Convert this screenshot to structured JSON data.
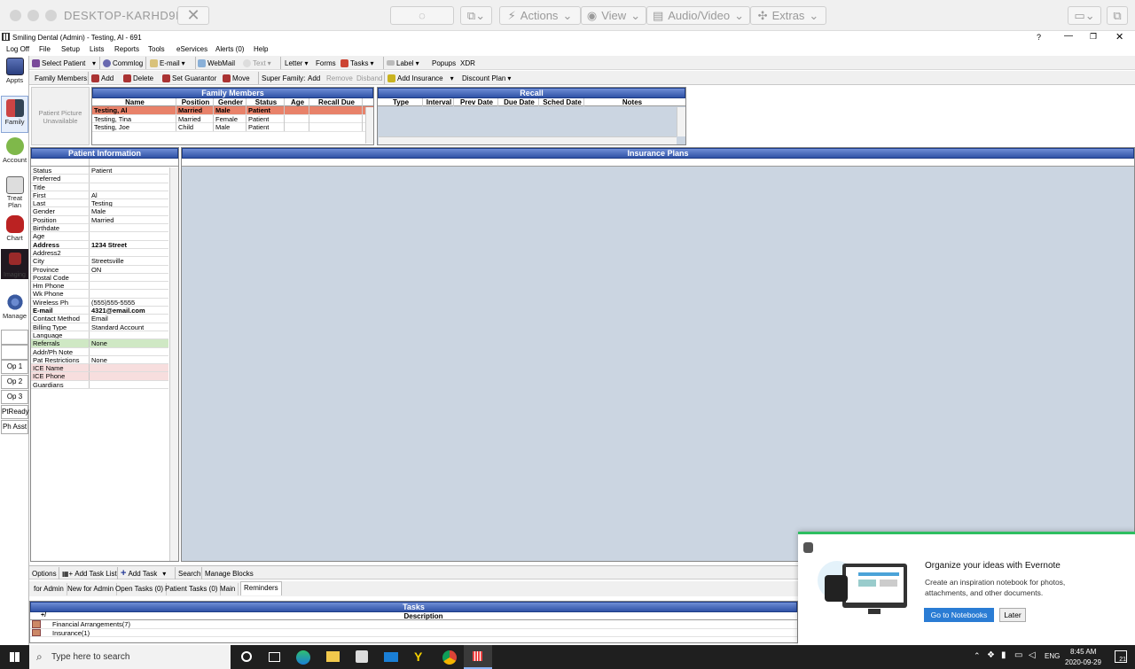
{
  "rd": {
    "host": "DESKTOP-KARHD9I",
    "actions": "Actions",
    "view": "View",
    "audio_video": "Audio/Video",
    "extras": "Extras"
  },
  "app": {
    "title": "Smiling Dental (Admin) - Testing, Al - 691",
    "help": "?"
  },
  "menu": [
    "Log Off",
    "File",
    "Setup",
    "Lists",
    "Reports",
    "Tools",
    "eServices",
    "Alerts (0)",
    "Help"
  ],
  "toolbar1": {
    "select_patient": "Select Patient",
    "commlog": "Commlog",
    "email": "E-mail",
    "webmail": "WebMail",
    "text": "Text",
    "letter": "Letter",
    "forms": "Forms",
    "tasks": "Tasks",
    "label": "Label",
    "popups": "Popups",
    "xdr": "XDR"
  },
  "toolbar2": {
    "family_members": "Family Members:",
    "add": "Add",
    "delete": "Delete",
    "set_guarantor": "Set Guarantor",
    "move": "Move",
    "super_family": "Super Family:",
    "sf_add": "Add",
    "sf_remove": "Remove",
    "sf_disband": "Disband",
    "add_insurance": "Add Insurance",
    "discount_plan": "Discount Plan"
  },
  "nav": {
    "appts": "Appts",
    "family": "Family",
    "account": "Account",
    "treat_plan_1": "Treat",
    "treat_plan_2": "Plan",
    "chart": "Chart",
    "imaging": "Imaging",
    "manage": "Manage",
    "ops": [
      "Op 1",
      "Op 2",
      "Op 3",
      "PtReady",
      "Ph Asst"
    ]
  },
  "picture": {
    "line1": "Patient Picture",
    "line2": "Unavailable"
  },
  "family": {
    "title": "Family Members",
    "columns": [
      "Name",
      "Position",
      "Gender",
      "Status",
      "Age",
      "Recall Due"
    ],
    "rows": [
      [
        "Testing, Al",
        "Married",
        "Male",
        "Patient",
        "",
        ""
      ],
      [
        "Testing, Tina",
        "Married",
        "Female",
        "Patient",
        "",
        ""
      ],
      [
        "Testing, Joe",
        "Child",
        "Male",
        "Patient",
        "",
        ""
      ]
    ]
  },
  "recall": {
    "title": "Recall",
    "columns": [
      "Type",
      "Interval",
      "Prev Date",
      "Due Date",
      "Sched Date",
      "Notes"
    ]
  },
  "patient_info": {
    "title": "Patient Information",
    "rows": [
      {
        "k": "Status",
        "v": "Patient"
      },
      {
        "k": "Preferred",
        "v": ""
      },
      {
        "k": "Title",
        "v": ""
      },
      {
        "k": "First",
        "v": "Al"
      },
      {
        "k": "Last",
        "v": "Testing"
      },
      {
        "k": "Gender",
        "v": "Male"
      },
      {
        "k": "Position",
        "v": "Married"
      },
      {
        "k": "Birthdate",
        "v": ""
      },
      {
        "k": "Age",
        "v": ""
      },
      {
        "k": "Address",
        "v": "1234 Street"
      },
      {
        "k": "Address2",
        "v": ""
      },
      {
        "k": "City",
        "v": "Streetsville"
      },
      {
        "k": "Province",
        "v": "ON"
      },
      {
        "k": "Postal Code",
        "v": ""
      },
      {
        "k": "Hm Phone",
        "v": ""
      },
      {
        "k": "Wk Phone",
        "v": ""
      },
      {
        "k": "Wireless Ph",
        "v": "(555)555-5555"
      },
      {
        "k": "E-mail",
        "v": "4321@email.com"
      },
      {
        "k": "Contact Method",
        "v": "Email"
      },
      {
        "k": "Billing Type",
        "v": "Standard Account"
      },
      {
        "k": "Language",
        "v": ""
      },
      {
        "k": "Referrals",
        "v": "None"
      },
      {
        "k": "Addr/Ph Note",
        "v": ""
      },
      {
        "k": "Pat Restrictions",
        "v": "None"
      },
      {
        "k": "ICE Name",
        "v": ""
      },
      {
        "k": "ICE Phone",
        "v": ""
      },
      {
        "k": "Guardians",
        "v": ""
      }
    ]
  },
  "insurance": {
    "title": "Insurance Plans"
  },
  "taskbar_tools": {
    "options": "Options",
    "add_task_list": "Add Task List",
    "add_task": "Add Task",
    "search": "Search",
    "manage_blocks": "Manage Blocks"
  },
  "task_tabs": [
    "for Admin",
    "New for Admin",
    "Open Tasks (0)",
    "Patient Tasks (0)",
    "Main",
    "Reminders"
  ],
  "tasks": {
    "title": "Tasks",
    "col_toggle": "+/",
    "col_desc": "Description",
    "rows": [
      "Financial Arrangements(7)",
      "Insurance(1)"
    ]
  },
  "toast": {
    "title": "Organize your ideas with Evernote",
    "body": "Create an inspiration notebook for photos, attachments, and other documents.",
    "primary": "Go to Notebooks",
    "secondary": "Later"
  },
  "win_taskbar": {
    "search_placeholder": "Type here to search",
    "lang": "ENG",
    "time": "8:45 AM",
    "date": "2020-09-29",
    "badge": "21"
  },
  "colors": {
    "header_blue": "#2f52a6",
    "selected_row": "#e8826a",
    "referral_green": "#cfe8c4",
    "ice_pink": "#f7dede",
    "evernote_green": "#2dbe60",
    "primary_button": "#2a7cd4"
  }
}
